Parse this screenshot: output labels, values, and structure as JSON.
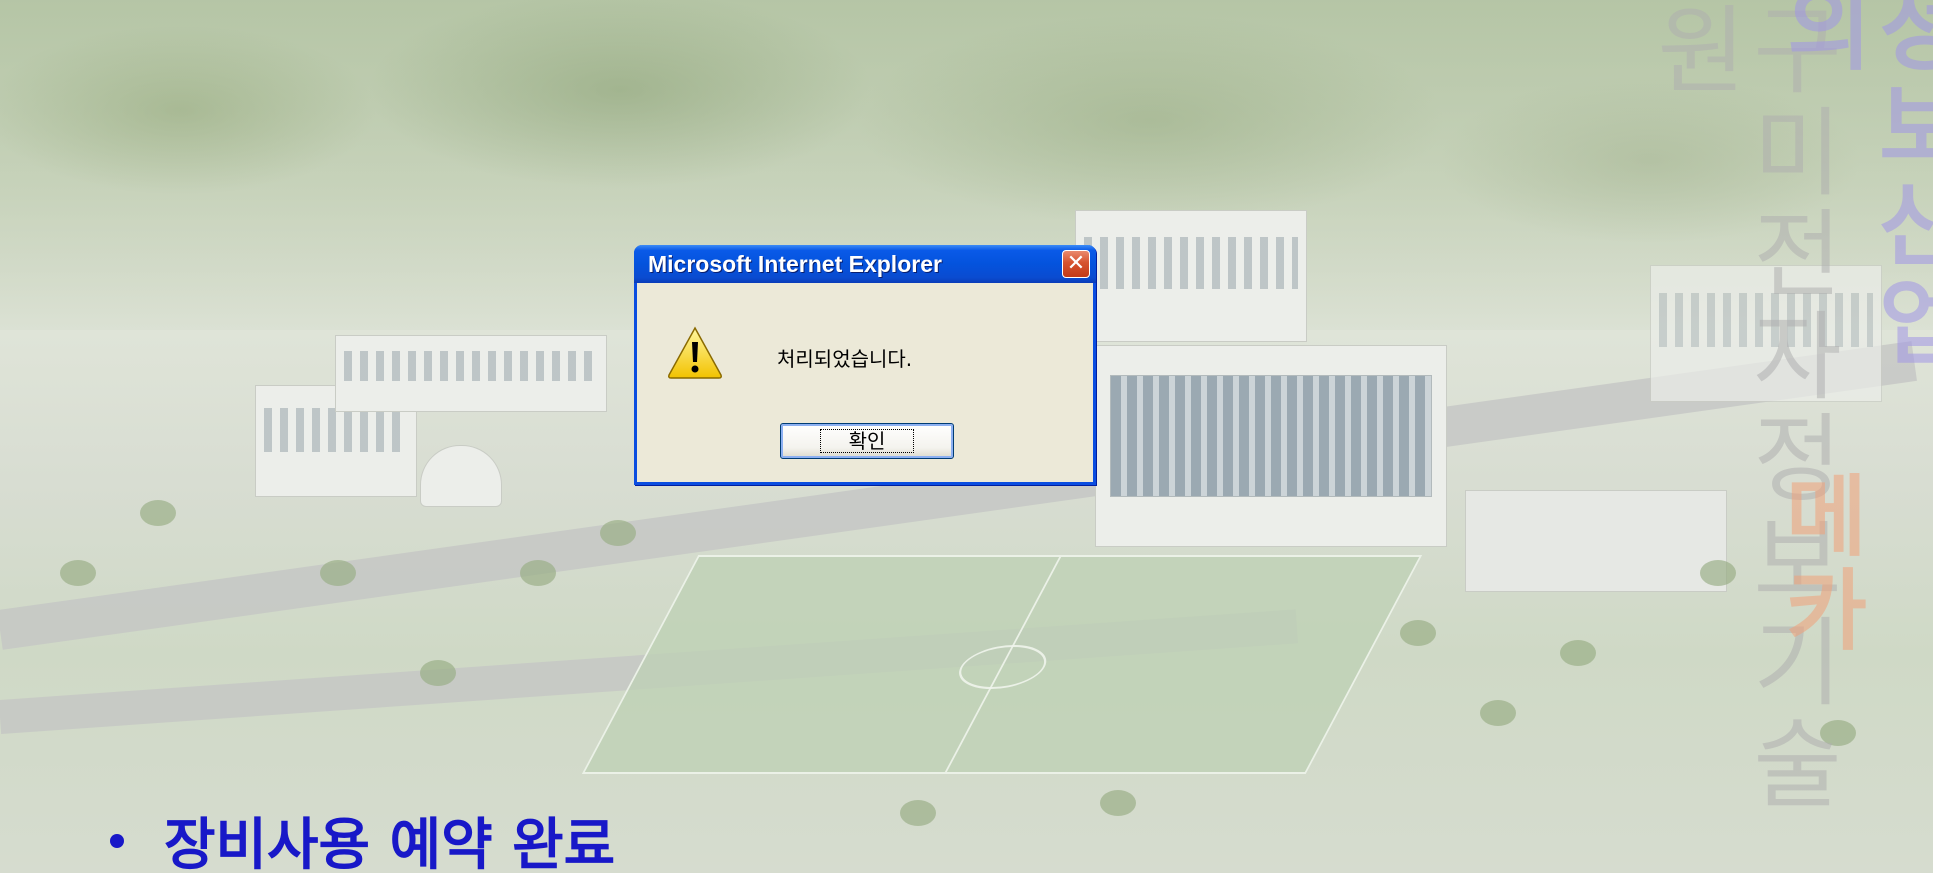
{
  "dialog": {
    "title": "Microsoft Internet Explorer",
    "close_symbol": "✕",
    "message": "처리되었습니다.",
    "ok_label": "확인",
    "icon": "warning-icon"
  },
  "watermark": {
    "vertical_main": "구미전자정보기술원",
    "vertical_side": "정보산업의",
    "vertical_side2": "메카"
  },
  "caption": {
    "text": "장비사용 예약 완료"
  },
  "colors": {
    "titlebar": "#0453dd",
    "caption": "#1818c8",
    "dialog_bg": "#ece9d8"
  }
}
